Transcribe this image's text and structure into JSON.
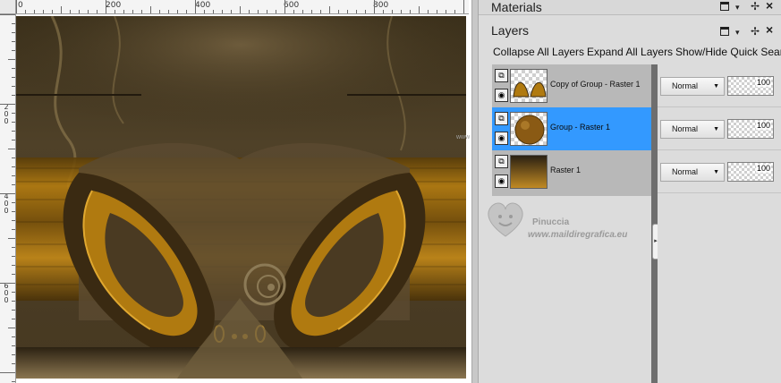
{
  "colors": {
    "selected_row": "#3399ff",
    "panel_bg": "#dcdcdc",
    "layers_list_bg": "#b8b8b8",
    "art_gold": "#c8901a",
    "art_dark": "#3d2f18"
  },
  "ruler": {
    "h_labels": [
      "0",
      "200",
      "400",
      "600",
      "800"
    ],
    "v_labels": [
      "2 0 0",
      "4 0 0",
      "6 0 0"
    ]
  },
  "materials": {
    "title": "Materials"
  },
  "layers_panel": {
    "title": "Layers",
    "toolbar": {
      "collapse": "Collapse All Layers",
      "expand": "Expand All Layers",
      "show_hide": "Show/Hide Quick Sear"
    },
    "layers": [
      {
        "name": "Copy of Group - Raster 1",
        "blend": "Normal",
        "opacity": "100",
        "selected": false,
        "thumb_icon": "butterfly-thumbnail"
      },
      {
        "name": "Group - Raster 1",
        "blend": "Normal",
        "opacity": "100",
        "selected": true,
        "thumb_icon": "sphere-thumbnail"
      },
      {
        "name": "Raster 1",
        "blend": "Normal",
        "opacity": "100",
        "selected": false,
        "thumb_icon": "gradient-thumbnail"
      }
    ]
  },
  "watermark": {
    "line1": "Pinuccia",
    "line2": "www.maildiregrafica.eu",
    "side": "www"
  }
}
